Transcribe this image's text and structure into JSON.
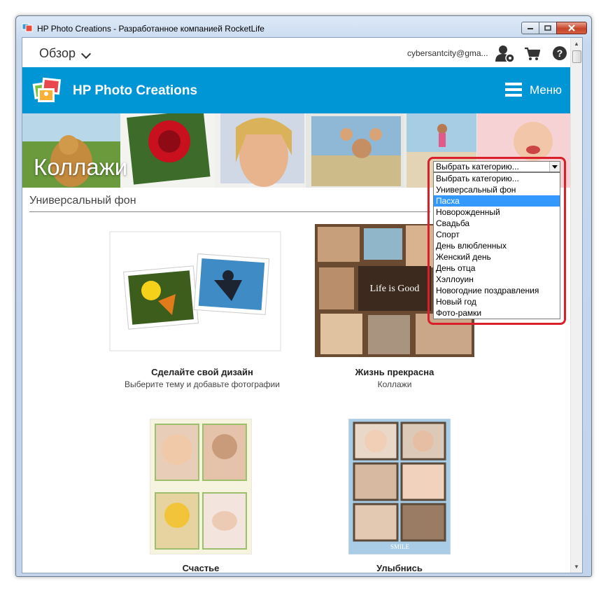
{
  "window": {
    "title": "HP Photo Creations - Разработанное компанией RocketLife"
  },
  "topbar": {
    "nav_label": "Обзор",
    "email": "cybersantcity@gma...",
    "icons": [
      "user-settings-icon",
      "cart-icon",
      "help-icon"
    ],
    "help_glyph": "?"
  },
  "header": {
    "brand": "HP Photo Creations",
    "menu_label": "Меню",
    "color": "#0096d6"
  },
  "hero": {
    "title": "Коллажи"
  },
  "category_select": {
    "selected": "Выбрать категорию...",
    "options": [
      "Выбрать категорию...",
      "Универсальный фон",
      "Пасха",
      "Новорожденный",
      "Свадьба",
      "Спорт",
      "День влюбленных",
      "Женский день",
      "День отца",
      "Хэллоуин",
      "Новогодние поздравления",
      "Новый год",
      "Фото-рамки"
    ],
    "highlighted_index": 2,
    "highlight_color": "#d9202a"
  },
  "section": {
    "title": "Универсальный фон"
  },
  "cards": [
    {
      "title": "Сделайте свой дизайн",
      "subtitle": "Выберите тему и добавьте фотографии"
    },
    {
      "title": "Жизнь прекрасна",
      "subtitle": "Коллажи",
      "overlay_text": "Life is Good"
    },
    {
      "title": "Счастье",
      "subtitle": ""
    },
    {
      "title": "Улыбнись",
      "subtitle": "",
      "overlay_text": "SMILE"
    }
  ]
}
